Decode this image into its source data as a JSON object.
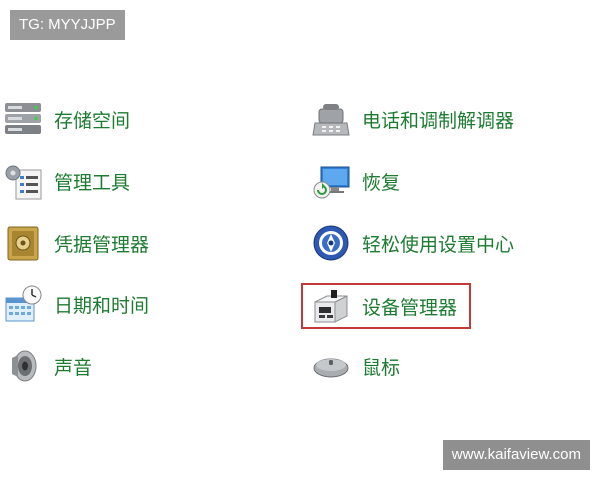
{
  "tag": {
    "text": "TG: MYYJJPP"
  },
  "watermark": {
    "text": "www.kaifaview.com"
  },
  "control_panel": {
    "left_items": [
      {
        "label": "存储空间",
        "icon": "storage-spaces-icon"
      },
      {
        "label": "管理工具",
        "icon": "administrative-tools-icon"
      },
      {
        "label": "凭据管理器",
        "icon": "credential-manager-icon"
      },
      {
        "label": "日期和时间",
        "icon": "date-time-icon"
      },
      {
        "label": "声音",
        "icon": "sound-icon"
      }
    ],
    "right_items": [
      {
        "label": "电话和调制解调器",
        "icon": "phone-modem-icon"
      },
      {
        "label": "恢复",
        "icon": "recovery-icon"
      },
      {
        "label": "轻松使用设置中心",
        "icon": "ease-of-access-icon"
      },
      {
        "label": "设备管理器",
        "icon": "device-manager-icon",
        "highlighted": true
      },
      {
        "label": "鼠标",
        "icon": "mouse-icon"
      }
    ]
  },
  "colors": {
    "link": "#1e7b32",
    "highlight_border": "#c0393b"
  }
}
